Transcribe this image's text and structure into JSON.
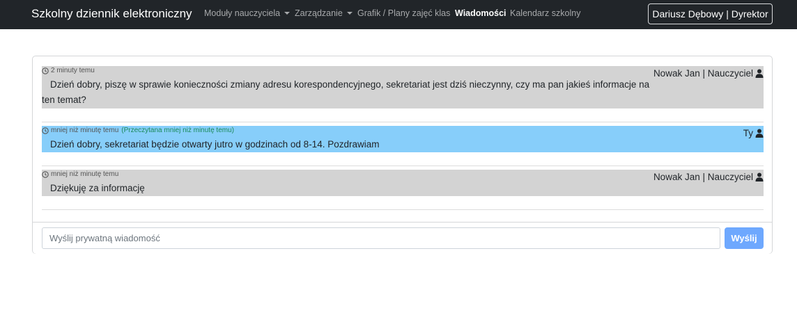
{
  "navbar": {
    "brand": "Szkolny dziennik elektroniczny",
    "items": [
      {
        "label": "Moduły nauczyciela",
        "dropdown": true
      },
      {
        "label": "Zarządzanie",
        "dropdown": true
      },
      {
        "label": "Grafik / Plany zajęć klas",
        "dropdown": false
      },
      {
        "label": "Wiadomości",
        "dropdown": false,
        "active": true
      },
      {
        "label": "Kalendarz szkolny",
        "dropdown": false
      }
    ],
    "user_button": "Dariusz Dębowy | Dyrektor"
  },
  "messages": [
    {
      "time": "2 minuty temu",
      "read_status": "",
      "author": "Nowak Jan | Nauczyciel",
      "text": "Dzień dobry, piszę w sprawie konieczności zmiany adresu korespondencyjnego, sekretariat jest dziś nieczynny, czy ma pan jakieś informacje na ten temat?",
      "direction": "incoming"
    },
    {
      "time": "mniej niż minutę temu",
      "read_status": "(Przeczytana mniej niż minutę temu)",
      "author": "Ty",
      "text": "Dzień dobry, sekretariat będzie otwarty jutro w godzinach od 8-14. Pozdrawiam",
      "direction": "outgoing"
    },
    {
      "time": "mniej niż minutę temu",
      "read_status": "",
      "author": "Nowak Jan | Nauczyciel",
      "text": "Dziękuję za informację",
      "direction": "incoming"
    }
  ],
  "composer": {
    "placeholder": "Wyślij prywatną wiadomość",
    "value": "",
    "send_label": "Wyślij"
  },
  "colors": {
    "navbar_bg": "#212529",
    "incoming_bg": "#d3d3d3",
    "outgoing_bg": "#87cefa",
    "send_button_bg": "#6ea8fe",
    "read_status": "#1b8a5a"
  }
}
